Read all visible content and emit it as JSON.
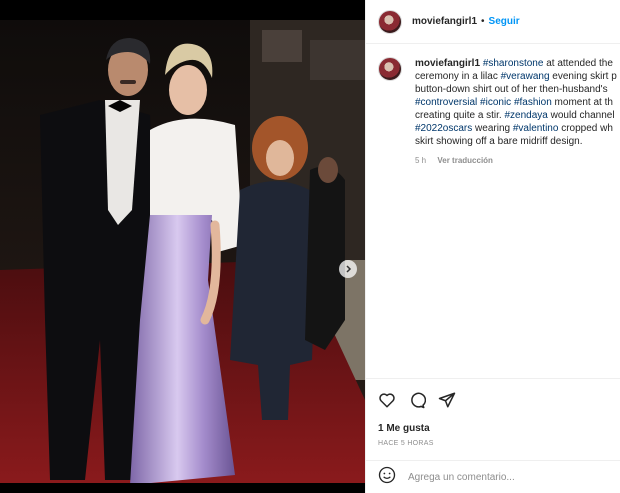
{
  "post": {
    "username": "moviefangirl1",
    "separator": "•",
    "follow_label": "Seguir"
  },
  "caption": {
    "username": "moviefangirl1",
    "lines": [
      [
        {
          "t": "#sharonstone",
          "tag": true
        },
        {
          "t": " at attended the",
          "tag": false
        }
      ],
      [
        {
          "t": "ceremony in a lilac ",
          "tag": false
        },
        {
          "t": "#verawang",
          "tag": true
        },
        {
          "t": " evening skirt p",
          "tag": false
        }
      ],
      [
        {
          "t": "button-down shirt out of her then-husband's",
          "tag": false
        }
      ],
      [
        {
          "t": "#controversial",
          "tag": true
        },
        {
          "t": " ",
          "tag": false
        },
        {
          "t": "#iconic",
          "tag": true
        },
        {
          "t": " ",
          "tag": false
        },
        {
          "t": "#fashion",
          "tag": true
        },
        {
          "t": " moment at th",
          "tag": false
        }
      ],
      [
        {
          "t": "creating quite a stir. ",
          "tag": false
        },
        {
          "t": "#zendaya",
          "tag": true
        },
        {
          "t": " would channel",
          "tag": false
        }
      ],
      [
        {
          "t": "#2022oscars",
          "tag": true
        },
        {
          "t": " wearing ",
          "tag": false
        },
        {
          "t": "#valentino",
          "tag": true
        },
        {
          "t": " cropped wh",
          "tag": false
        }
      ],
      [
        {
          "t": "skirt showing off a bare midriff design.",
          "tag": false
        }
      ]
    ],
    "time": "5 h",
    "translate": "Ver traducción"
  },
  "actions": {
    "icons": [
      "heart-icon",
      "comment-icon",
      "share-icon"
    ],
    "likes": "1 Me gusta",
    "time_ago": "HACE 5 HORAS"
  },
  "comment_box": {
    "placeholder": "Agrega un comentario...",
    "emoji_icon": "emoji-icon"
  },
  "carousel": {
    "next_icon": "chevron-right-icon",
    "slides": 2,
    "active": 0
  },
  "colors": {
    "link": "#0095f6",
    "hashtag": "#00376b",
    "secondary": "#8e8e8e",
    "carpet": "#7a1416",
    "gown": "#b8a3d8"
  }
}
